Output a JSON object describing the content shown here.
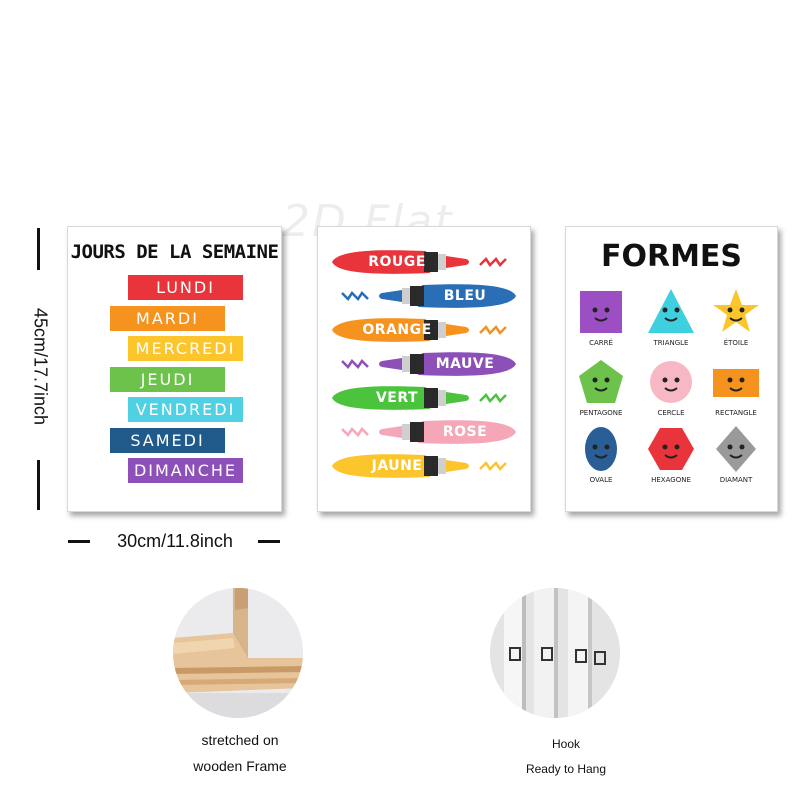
{
  "poster_days": {
    "title": "JOURS DE LA SEMAINE",
    "days": [
      {
        "label": "LUNDI",
        "color": "#e8343a"
      },
      {
        "label": "MARDI",
        "color": "#f6921e"
      },
      {
        "label": "MERCREDI",
        "color": "#fcc52c"
      },
      {
        "label": "JEUDI",
        "color": "#6cc24a"
      },
      {
        "label": "VENDREDI",
        "color": "#4fd0e3"
      },
      {
        "label": "SAMEDI",
        "color": "#1f5a8a"
      },
      {
        "label": "DIMANCHE",
        "color": "#8d4fb8"
      }
    ]
  },
  "poster_colors": {
    "colors": [
      {
        "label": "ROUGE",
        "color": "#e8343a"
      },
      {
        "label": "BLEU",
        "color": "#2a6fb5"
      },
      {
        "label": "ORANGE",
        "color": "#f6921e"
      },
      {
        "label": "MAUVE",
        "color": "#8d4fb8"
      },
      {
        "label": "VERT",
        "color": "#4cc33c"
      },
      {
        "label": "ROSE",
        "color": "#f5a7b8"
      },
      {
        "label": "JAUNE",
        "color": "#fcc52c"
      }
    ]
  },
  "poster_shapes": {
    "title": "FORMES",
    "shapes": [
      {
        "label": "CARRÉ",
        "color": "#9b4fc2",
        "icon": "square-icon"
      },
      {
        "label": "TRIANGLE",
        "color": "#3fd0e0",
        "icon": "triangle-icon"
      },
      {
        "label": "ÉTOILE",
        "color": "#fcc52c",
        "icon": "star-icon"
      },
      {
        "label": "PENTAGONE",
        "color": "#6cc24a",
        "icon": "pentagon-icon"
      },
      {
        "label": "CERCLE",
        "color": "#f7b8c3",
        "icon": "circle-icon"
      },
      {
        "label": "RECTANGLE",
        "color": "#f6921e",
        "icon": "rectangle-icon"
      },
      {
        "label": "OVALE",
        "color": "#2a5e96",
        "icon": "oval-icon"
      },
      {
        "label": "HEXAGONE",
        "color": "#e8343a",
        "icon": "hexagon-icon"
      },
      {
        "label": "DIAMANT",
        "color": "#9a9a9a",
        "icon": "diamond-icon"
      }
    ]
  },
  "watermark": "2D Flat",
  "dimensions": {
    "height_label": "45cm/17.7inch",
    "width_label": "30cm/11.8inch"
  },
  "features": {
    "frame_caption_line1": "stretched on",
    "frame_caption_line2": "wooden Frame",
    "hook_caption_line1": "Hook",
    "hook_caption_line2": "Ready to Hang"
  }
}
